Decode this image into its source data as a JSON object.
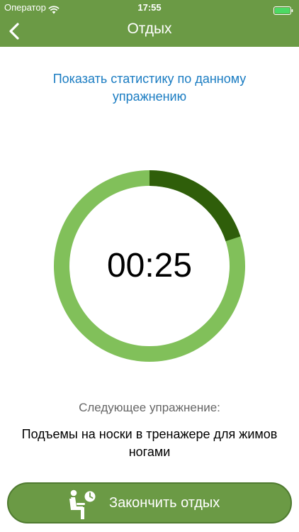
{
  "status_bar": {
    "carrier": "Оператор",
    "time": "17:55"
  },
  "nav": {
    "title": "Отдых",
    "back_icon": "chevron-left-icon"
  },
  "stats_link": "Показать статистику по данному упражнению",
  "timer": {
    "time": "00:25",
    "progress": 0.2,
    "track_color": "#81c05a",
    "progress_color": "#2f5e0a"
  },
  "next": {
    "label": "Следующее упражнение:",
    "name": "Подъемы на носки в тренажере для жимов ногами"
  },
  "finish_button": {
    "label": "Закончить отдых",
    "icon": "resting-person-clock-icon"
  },
  "colors": {
    "brand": "#6b9a45",
    "link": "#1a7cc2"
  }
}
